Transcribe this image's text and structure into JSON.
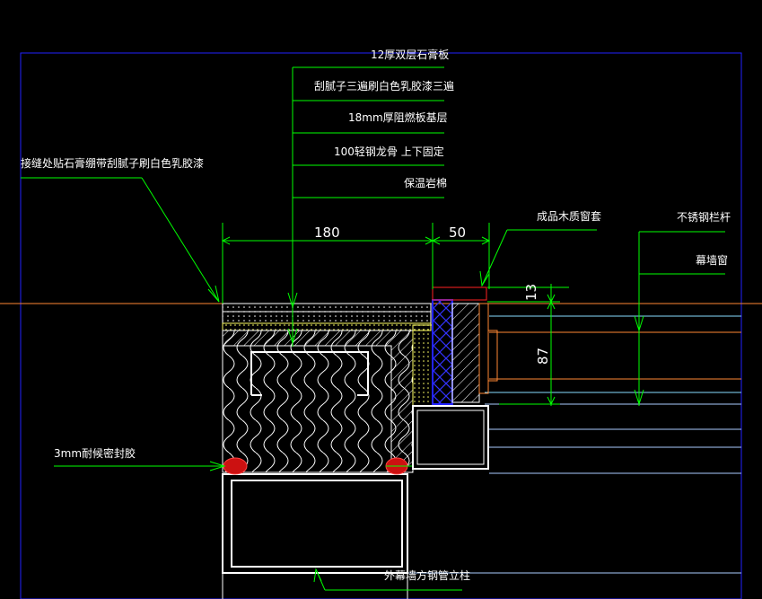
{
  "labels": {
    "gypsum": "12厚双层石膏板",
    "putty": "刮腻子三遍刷白色乳胶漆三遍",
    "fireboard": "18mm厚阻燃板基层",
    "keel": "100轻钢龙骨 上下固定",
    "insulation": "保温岩棉",
    "joint": "接缝处贴石膏绷带刮腻子刷白色乳胶漆",
    "window_trim": "成品木质窗套",
    "railing": "不锈钢栏杆",
    "curtain_window": "幕墙窗",
    "sealant": "3mm耐候密封胶",
    "steel_column": "外幕墙方钢管立柱"
  },
  "dimensions": {
    "width_main": "180",
    "width_frame": "50",
    "height_top": "13",
    "height_window": "87"
  },
  "colors": {
    "frame_blue": "#2222ff",
    "leader_green": "#00ff00",
    "dim_green": "#00ff00",
    "wall_white": "#ffffff",
    "orange": "#ff8833",
    "cyan": "#88ddff",
    "yellow": "#ffff66",
    "sealant_red": "#ff2222"
  }
}
